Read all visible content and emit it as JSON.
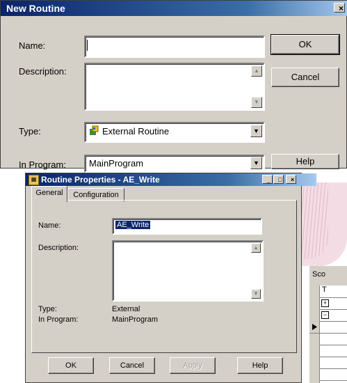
{
  "new_routine": {
    "title": "New Routine",
    "close_label": "×",
    "name_label": "Name:",
    "name_value": "",
    "description_label": "Description:",
    "description_value": "",
    "type_label": "Type:",
    "type_value": "External Routine",
    "in_program_label": "In Program:",
    "in_program_value": "MainProgram",
    "ok_label": "OK",
    "cancel_label": "Cancel",
    "help_label": "Help"
  },
  "routine_properties": {
    "title": "Routine Properties - AE_Write",
    "tabs": [
      "General",
      "Configuration"
    ],
    "name_label": "Name:",
    "name_value": "AE_Write",
    "description_label": "Description:",
    "description_value": "",
    "type_label": "Type:",
    "type_value": "External",
    "in_program_label": "In Program:",
    "in_program_value": "MainProgram",
    "ok_label": "OK",
    "cancel_label": "Cancel",
    "apply_label": "Apply",
    "help_label": "Help"
  },
  "background_panel": {
    "title": "Sco",
    "header_cell": "T",
    "expand_glyphs": [
      "+",
      "−"
    ]
  }
}
